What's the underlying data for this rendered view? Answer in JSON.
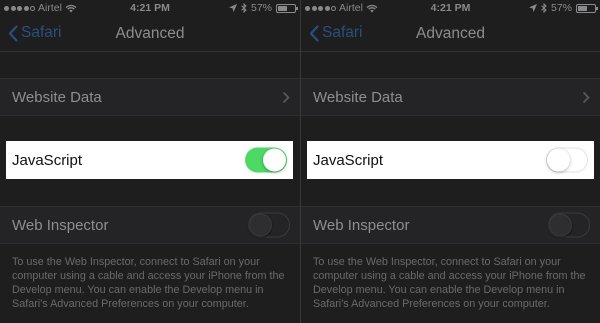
{
  "status_bar": {
    "carrier": "Airtel",
    "time": "4:21 PM",
    "battery": "57%",
    "battery_level": 0.57
  },
  "nav": {
    "back_label": "Safari",
    "title": "Advanced"
  },
  "settings": {
    "website_data": "Website Data",
    "javascript": "JavaScript",
    "web_inspector": "Web Inspector",
    "footer": "To use the Web Inspector, connect to Safari on your computer using a cable and access your iPhone from the Develop menu. You can enable the Develop menu in Safari's Advanced Preferences on your computer."
  },
  "screens": [
    {
      "javascript_enabled": true,
      "web_inspector_enabled": false
    },
    {
      "javascript_enabled": false,
      "web_inspector_enabled": false
    }
  ],
  "colors": {
    "toggle_on": "#4cd964",
    "link_blue": "#2a4f7f"
  }
}
